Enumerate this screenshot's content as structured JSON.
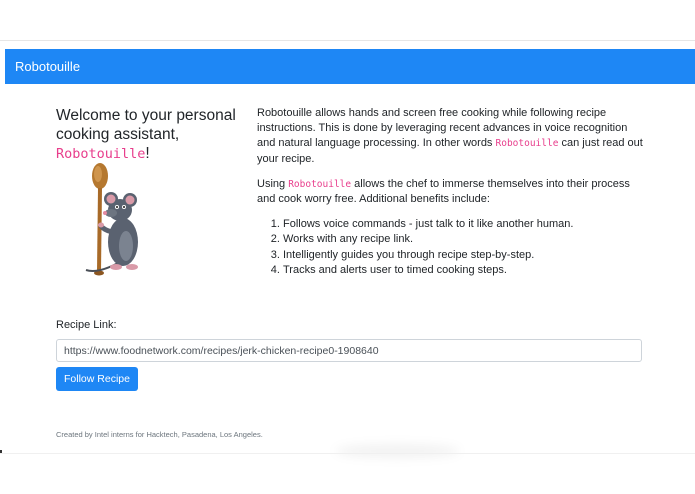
{
  "navbar": {
    "brand": "Robotouille"
  },
  "hero": {
    "heading_line": "Welcome to your personal cooking assistant,",
    "heading_code": "Robotouille",
    "heading_punct": "!"
  },
  "description": {
    "p1_before": "Robotouille allows hands and screen free cooking while following recipe instructions. This is done by leveraging recent advances in voice recognition and natural language processing. In other words ",
    "p1_code": "Robotouille",
    "p1_after": " can just read out your recipe.",
    "p2_before": "Using ",
    "p2_code": "Robotouille",
    "p2_after": " allows the chef to immerse themselves into their process and cook worry free. Additional benefits include:",
    "benefits": [
      "Follows voice commands - just talk to it like another human.",
      "Works with any recipe link.",
      "Intelligently guides you through recipe step-by-step.",
      "Tracks and alerts user to timed cooking steps."
    ]
  },
  "recipe_form": {
    "label": "Recipe Link:",
    "input_value": "https://www.foodnetwork.com/recipes/jerk-chicken-recipe0-1908640",
    "button_label": "Follow Recipe"
  },
  "footer": {
    "text": "Created by Intel interns for Hacktech, Pasadena, Los Angeles."
  },
  "colors": {
    "primary": "#1e87f5",
    "code": "#e83e8c"
  },
  "icons": {
    "mascot": "rat-chef-with-wooden-spoon-icon"
  }
}
